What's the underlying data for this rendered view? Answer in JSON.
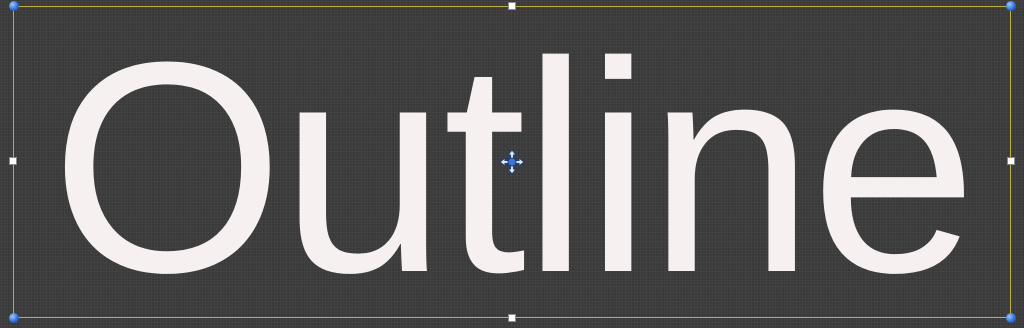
{
  "canvas": {
    "text": "Outline",
    "text_color": "#f7f0f0",
    "background_color": "#3b3b3b",
    "frame_color": "#bfae3a",
    "corner_handle_color": "#2f6fd6"
  },
  "icons": {
    "move_handle": "move-arrows-icon"
  }
}
